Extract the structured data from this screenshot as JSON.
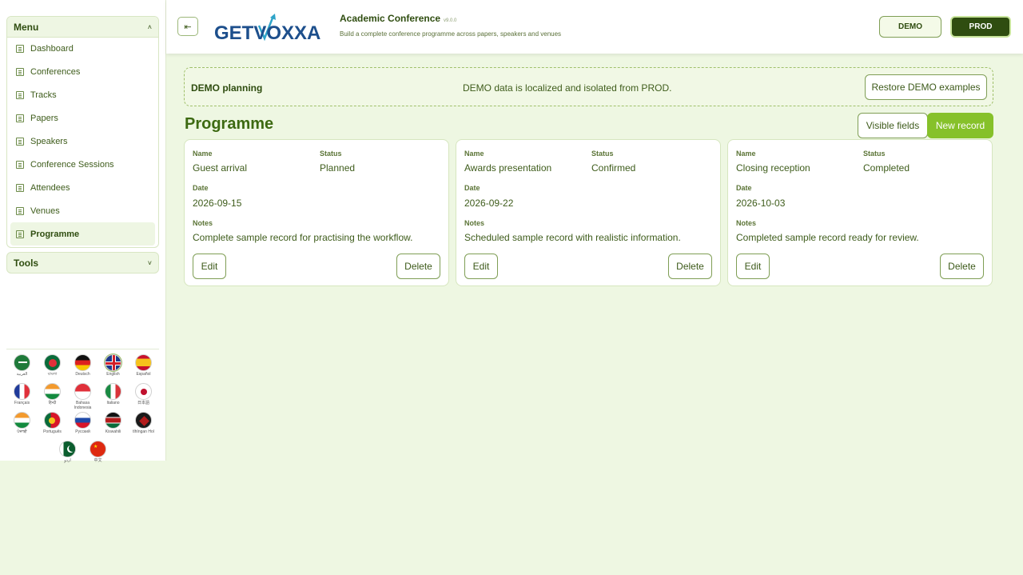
{
  "sidebar": {
    "menu_title": "Menu",
    "menu_chevron": "˄",
    "items": [
      {
        "label": "Dashboard",
        "icon": "list-icon"
      },
      {
        "label": "Conferences",
        "icon": "list-icon"
      },
      {
        "label": "Tracks",
        "icon": "list-icon"
      },
      {
        "label": "Papers",
        "icon": "list-icon"
      },
      {
        "label": "Speakers",
        "icon": "list-icon"
      },
      {
        "label": "Conference Sessions",
        "icon": "list-icon"
      },
      {
        "label": "Attendees",
        "icon": "list-icon"
      },
      {
        "label": "Venues",
        "icon": "list-icon"
      },
      {
        "label": "Programme",
        "icon": "list-icon",
        "active": true
      }
    ],
    "tools_title": "Tools",
    "tools_chevron": "˅",
    "languages": [
      {
        "label": "العربية",
        "flag": "saudi-arabia-flag"
      },
      {
        "label": "বাংলা",
        "flag": "bangladesh-flag"
      },
      {
        "label": "Deutsch",
        "flag": "germany-flag"
      },
      {
        "label": "English",
        "flag": "uk-flag",
        "selected": true
      },
      {
        "label": "Español",
        "flag": "spain-flag"
      },
      {
        "label": "Français",
        "flag": "france-flag"
      },
      {
        "label": "हिन्दी",
        "flag": "india-flag"
      },
      {
        "label": "Bahasa Indonesia",
        "flag": "indonesia-flag"
      },
      {
        "label": "Italiano",
        "flag": "italy-flag"
      },
      {
        "label": "日本語",
        "flag": "japan-flag"
      },
      {
        "label": "ਪੰਜਾਬੀ",
        "flag": "india-flag"
      },
      {
        "label": "Português",
        "flag": "portugal-flag"
      },
      {
        "label": "Русский",
        "flag": "russia-flag"
      },
      {
        "label": "Kiswahili",
        "flag": "kenya-flag"
      },
      {
        "label": "tlhIngan Hol",
        "flag": "klingon-flag"
      },
      {
        "label": "اردو",
        "flag": "pakistan-flag"
      },
      {
        "label": "中文",
        "flag": "china-flag"
      }
    ]
  },
  "header": {
    "collapse_icon": "⇤",
    "logo_text": "GETVOXXA",
    "app_title": "Academic Conference",
    "version": "v9.0.0",
    "subtitle": "Build a complete conference programme across papers, speakers and venues",
    "env_demo": "DEMO",
    "env_prod": "PROD"
  },
  "banner": {
    "title": "DEMO planning",
    "message": "DEMO data is localized and isolated from PROD.",
    "restore_label": "Restore DEMO examples"
  },
  "main": {
    "title": "Programme",
    "visible_fields_label": "Visible fields",
    "new_record_label": "New record",
    "field_labels": {
      "name": "Name",
      "status": "Status",
      "date": "Date",
      "notes": "Notes"
    },
    "edit_label": "Edit",
    "delete_label": "Delete",
    "records": [
      {
        "name": "Guest arrival",
        "status": "Planned",
        "date": "2026-09-15",
        "notes": "Complete sample record for practising the workflow."
      },
      {
        "name": "Awards presentation",
        "status": "Confirmed",
        "date": "2026-09-22",
        "notes": "Scheduled sample record with realistic information."
      },
      {
        "name": "Closing reception",
        "status": "Completed",
        "date": "2026-10-03",
        "notes": "Completed sample record ready for review."
      }
    ]
  },
  "colors": {
    "accent": "#86c12a",
    "dark": "#2f4d10",
    "page_bg": "#eef7e2"
  }
}
